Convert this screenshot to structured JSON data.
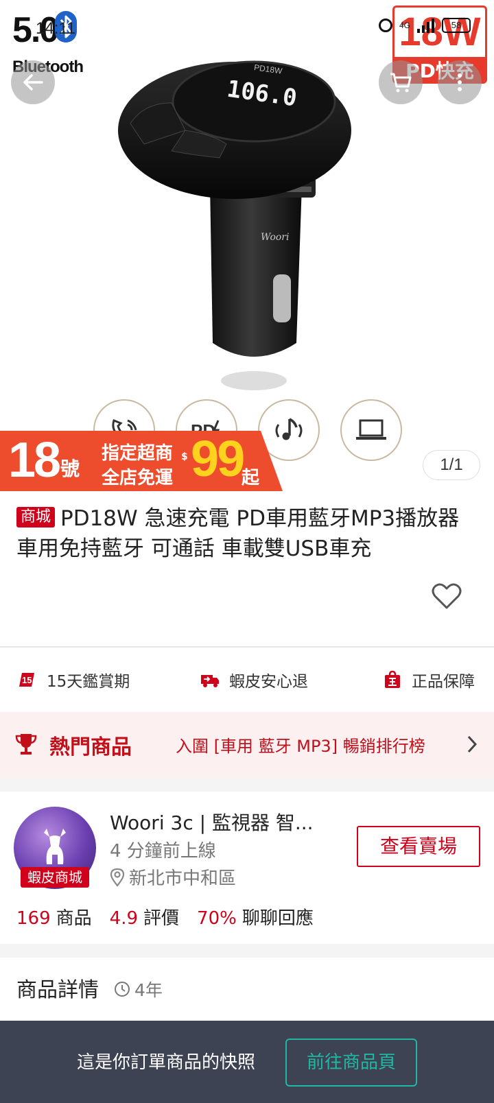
{
  "status_bar": {
    "time": "14:11",
    "bt_version": "5.0",
    "bt_label": "Bluetooth",
    "network": "4G",
    "battery": "58"
  },
  "image": {
    "badge_top": "18W",
    "badge_bottom": "PD快充",
    "device_display": "106.0",
    "device_brand": "PD18W",
    "watermark": "Woori",
    "pager": "1/1",
    "promo": {
      "day": "18",
      "day_suffix": "號",
      "line1": "指定超商",
      "line2": "全店免運",
      "currency": "$",
      "price": "99",
      "price_suffix": "起"
    }
  },
  "product": {
    "mall_tag": "商城",
    "title": "PD18W 急速充電 PD車用藍牙MP3播放器 車用免持藍牙 可通話 車載雙USB車充"
  },
  "guarantees": [
    {
      "label": "15天鑑賞期",
      "icon": "fifteen-day-icon"
    },
    {
      "label": "蝦皮安心退",
      "icon": "truck-return-icon"
    },
    {
      "label": "正品保障",
      "icon": "genuine-bag-icon"
    }
  ],
  "hot": {
    "title": "熱門商品",
    "rank": "入圍 [車用 藍牙 MP3] 暢銷排行榜"
  },
  "shop": {
    "name": "Woori 3c | 監視器 智...",
    "online": "4 分鐘前上線",
    "location": "新北市中和區",
    "badge": "蝦皮商城",
    "view_button": "查看賣場",
    "stats": [
      {
        "num": "169",
        "label": "商品"
      },
      {
        "num": "4.9",
        "label": "評價"
      },
      {
        "num": "70%",
        "label": "聊聊回應"
      }
    ]
  },
  "details": {
    "title": "商品詳情",
    "age": "4年"
  },
  "bottom": {
    "text": "這是你訂單商品的快照",
    "button": "前往商品頁"
  },
  "colors": {
    "brand_red": "#d0011b",
    "promo_orange": "#ee4d2d",
    "teal": "#1fb8a4",
    "bottom_bar": "#3e4353"
  }
}
